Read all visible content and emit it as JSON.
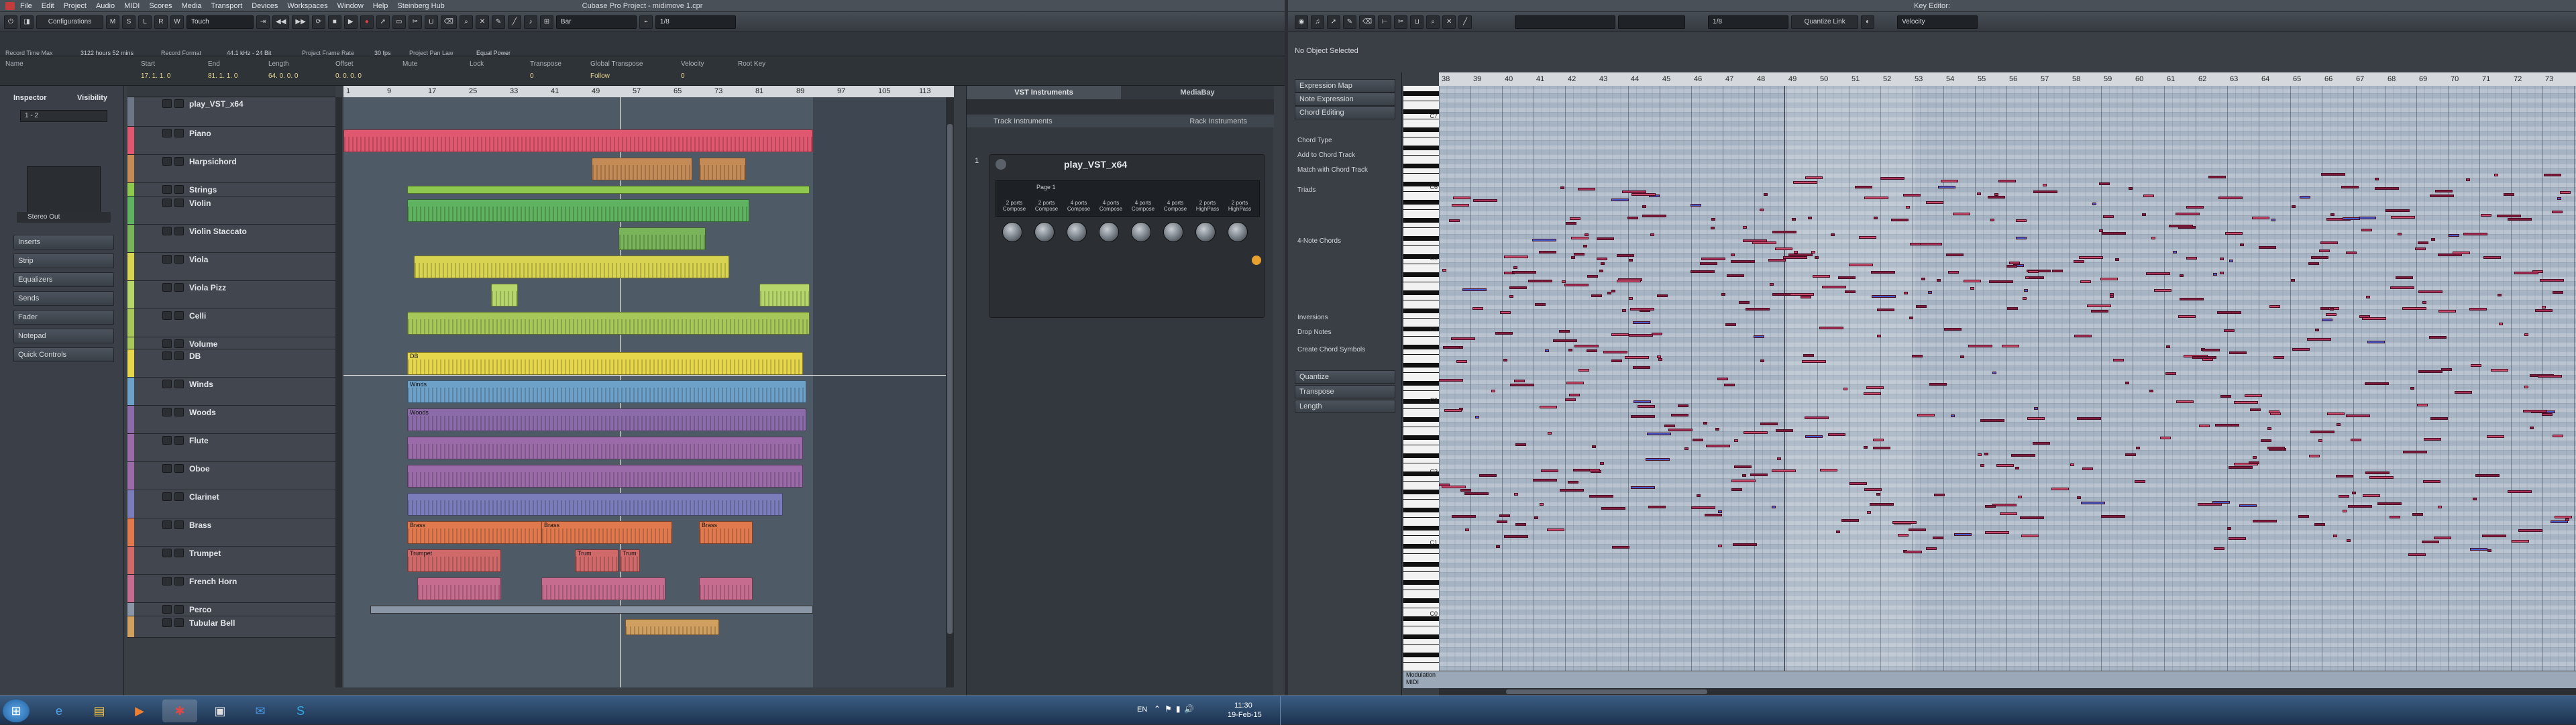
{
  "project_window": {
    "title": "Cubase Pro Project - midimove 1.cpr",
    "menu": [
      "File",
      "Edit",
      "Project",
      "Audio",
      "MIDI",
      "Scores",
      "Media",
      "Transport",
      "Devices",
      "Workspaces",
      "Window",
      "Help",
      "Steinberg Hub"
    ],
    "toolbar": {
      "configurations": "Configurations",
      "automation_mode": "Touch",
      "grid_type": "Bar",
      "quantize": "1/8"
    },
    "status": {
      "record_time": "Record Time Max",
      "record_time_value": "3122 hours 52 mins",
      "record_format": "Record Format",
      "record_format_value": "44.1 kHz - 24 Bit",
      "frame_rate": "Project Frame Rate",
      "frame_rate_value": "30 fps",
      "pan_law": "Project Pan Law",
      "pan_law_value": "Equal Power"
    },
    "info_line": {
      "headers": [
        "Name",
        "Start",
        "End",
        "Length",
        "Offset",
        "Mute",
        "Lock",
        "Transpose",
        "Global Transpose",
        "Velocity",
        "Root Key"
      ],
      "values": [
        "",
        "17. 1. 1. 0",
        "81. 1. 1. 0",
        "64. 0. 0. 0",
        "0. 0. 0. 0",
        "",
        "",
        "0",
        "Follow",
        "0",
        ""
      ]
    },
    "inspector": {
      "tabs": [
        "Inspector",
        "Visibility"
      ],
      "track_name": "1 - 2",
      "out": "Stereo Out",
      "sections": [
        "Inserts",
        "Strip",
        "Equalizers",
        "Sends",
        "Fader",
        "Notepad",
        "Quick Controls"
      ]
    },
    "ruler": [
      "1",
      "9",
      "17",
      "25",
      "33",
      "41",
      "49",
      "57",
      "65",
      "73",
      "81",
      "89",
      "97",
      "105",
      "113"
    ],
    "tracks": [
      {
        "name": "play_VST_x64",
        "color": "#6c7686"
      },
      {
        "name": "Piano",
        "color": "#e0586f"
      },
      {
        "name": "Harpsichord",
        "color": "#c58b57"
      },
      {
        "name": "Strings",
        "color": "#8fc84f"
      },
      {
        "name": "Violin",
        "color": "#5fb25f"
      },
      {
        "name": "Violin Staccato",
        "color": "#79b45a"
      },
      {
        "name": "Viola",
        "color": "#d8d451"
      },
      {
        "name": "Viola Pizz",
        "color": "#b6d66b"
      },
      {
        "name": "Celli",
        "color": "#a7c75b"
      },
      {
        "name": "Volume",
        "color": "#a7c75b"
      },
      {
        "name": "DB",
        "color": "#e5d64c"
      },
      {
        "name": "Winds",
        "color": "#6da1c8"
      },
      {
        "name": "Woods",
        "color": "#8c6ca8"
      },
      {
        "name": "Flute",
        "color": "#9a6ba8"
      },
      {
        "name": "Oboe",
        "color": "#9a6ba8"
      },
      {
        "name": "Clarinet",
        "color": "#7b7dbb"
      },
      {
        "name": "Brass",
        "color": "#e07a4e"
      },
      {
        "name": "Trumpet",
        "color": "#d06a6a"
      },
      {
        "name": "French Horn",
        "color": "#c66d8f"
      },
      {
        "name": "Perco",
        "color": "#8a96a6"
      },
      {
        "name": "Tubular Bell",
        "color": "#d0a060"
      }
    ],
    "part_labels": [
      "DB",
      "Winds",
      "Woods",
      "Brass",
      "Trumpet",
      "Trum",
      "Trum"
    ]
  },
  "vst_rack": {
    "tabs": [
      "VST Instruments",
      "MediaBay"
    ],
    "sections": [
      "Track Instruments",
      "Rack Instruments"
    ],
    "slot": "1",
    "instrument": "play_VST_x64",
    "page": "Page 1",
    "knob_labels": [
      "2 ports Compose",
      "2 ports Compose",
      "4 ports Compose",
      "4 ports Compose",
      "4 ports Compose",
      "4 ports Compose",
      "2 ports HighPass",
      "2 ports HighPass"
    ]
  },
  "key_editor": {
    "title": "Key Editor:",
    "status": "No Object Selected",
    "quantize": "1/8",
    "quantize_link": "Quantize Link",
    "velocity": "Velocity",
    "ruler": [
      "38",
      "39",
      "40",
      "41",
      "42",
      "43",
      "44",
      "45",
      "46",
      "47",
      "48",
      "49",
      "50",
      "51",
      "52",
      "53",
      "54",
      "55",
      "56",
      "57",
      "58",
      "59",
      "60",
      "61",
      "62",
      "63",
      "64",
      "65",
      "66",
      "67",
      "68",
      "69",
      "70",
      "71",
      "72",
      "73"
    ],
    "sections": [
      "Expression Map",
      "Note Expression",
      "Chord Editing",
      "Quantize",
      "Transpose",
      "Length"
    ],
    "chord_items": [
      "Chord Type",
      "Add to Chord Track",
      "Match with Chord Track",
      "Triads",
      "4-Note Chords",
      "Inversions",
      "Drop Notes",
      "Create Chord Symbols"
    ],
    "keys": [
      "C7",
      "C6",
      "C5",
      "C4",
      "C3",
      "C2",
      "C1",
      "C0"
    ],
    "controller": "Modulation",
    "controller_sub": "MIDI"
  },
  "taskbar": {
    "lang": "EN",
    "time": "11:30",
    "date": "19-Feb-15"
  },
  "colors": {
    "accent": "#f0c040",
    "note": "#8b2145"
  }
}
